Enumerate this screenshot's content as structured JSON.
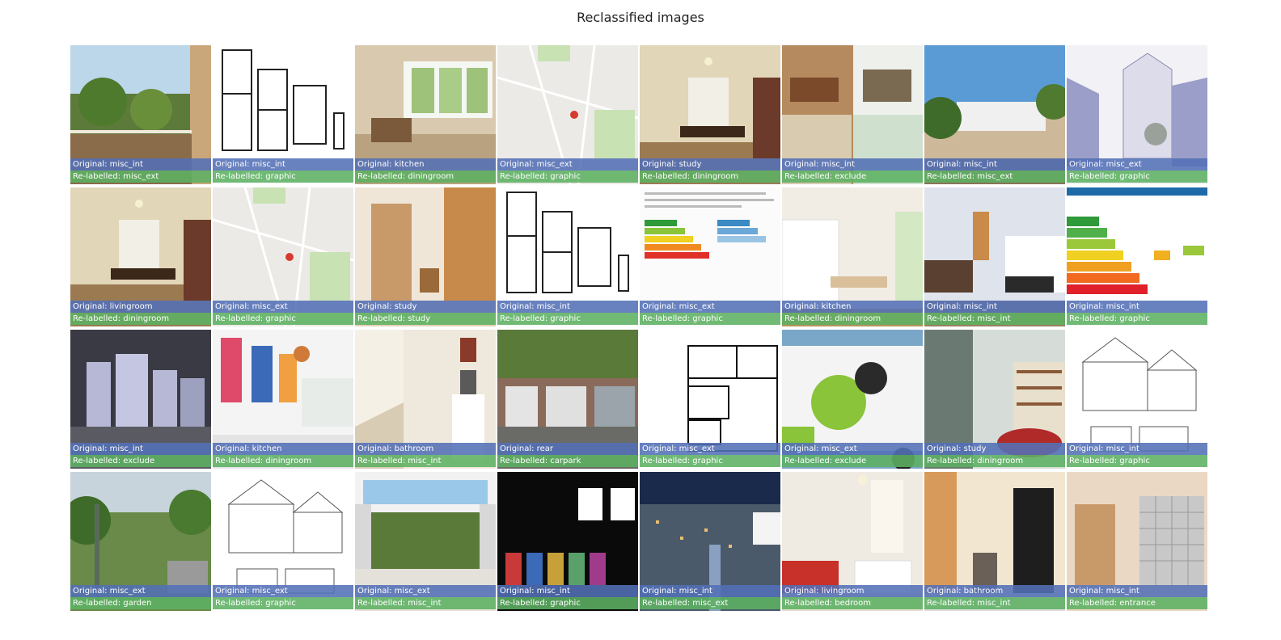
{
  "title": "Reclassified images",
  "colors": {
    "original_band": "#536fb6",
    "relabelled_band": "#5cb062"
  },
  "images": [
    {
      "original": "Original: misc_int",
      "relabelled": "Re-labelled: misc_ext",
      "scene": "balcony-view"
    },
    {
      "original": "Original: misc_int",
      "relabelled": "Re-labelled: graphic",
      "scene": "floorplan"
    },
    {
      "original": "Original: kitchen",
      "relabelled": "Re-labelled: diningroom",
      "scene": "room-window"
    },
    {
      "original": "Original: misc_ext",
      "relabelled": "Re-labelled: graphic",
      "scene": "map"
    },
    {
      "original": "Original: study",
      "relabelled": "Re-labelled: diningroom",
      "scene": "dining-room"
    },
    {
      "original": "Original: misc_int",
      "relabelled": "Re-labelled: exclude",
      "scene": "collage"
    },
    {
      "original": "Original: misc_int",
      "relabelled": "Re-labelled: misc_ext",
      "scene": "bungalow-garden"
    },
    {
      "original": "Original: misc_ext",
      "relabelled": "Re-labelled: graphic",
      "scene": "3d-render"
    },
    {
      "original": "Original: livingroom",
      "relabelled": "Re-labelled: diningroom",
      "scene": "dining-room"
    },
    {
      "original": "Original: misc_ext",
      "relabelled": "Re-labelled: graphic",
      "scene": "map"
    },
    {
      "original": "Original: study",
      "relabelled": "Re-labelled: study",
      "scene": "hallway"
    },
    {
      "original": "Original: misc_int",
      "relabelled": "Re-labelled: graphic",
      "scene": "floorplan"
    },
    {
      "original": "Original: misc_ext",
      "relabelled": "Re-labelled: graphic",
      "scene": "energy-doc"
    },
    {
      "original": "Original: kitchen",
      "relabelled": "Re-labelled: diningroom",
      "scene": "kitchen"
    },
    {
      "original": "Original: misc_int",
      "relabelled": "Re-labelled: misc_int",
      "scene": "living-kitchen"
    },
    {
      "original": "Original: misc_int",
      "relabelled": "Re-labelled: graphic",
      "scene": "energy-chart"
    },
    {
      "original": "Original: misc_int",
      "relabelled": "Re-labelled: exclude",
      "scene": "model"
    },
    {
      "original": "Original: kitchen",
      "relabelled": "Re-labelled: diningroom",
      "scene": "kitchen-art"
    },
    {
      "original": "Original: bathroom",
      "relabelled": "Re-labelled: misc_int",
      "scene": "stairs"
    },
    {
      "original": "Original: rear",
      "relabelled": "Re-labelled: carpark",
      "scene": "garages"
    },
    {
      "original": "Original: misc_ext",
      "relabelled": "Re-labelled: graphic",
      "scene": "floorplan-2"
    },
    {
      "original": "Original: misc_ext",
      "relabelled": "Re-labelled: exclude",
      "scene": "van"
    },
    {
      "original": "Original: study",
      "relabelled": "Re-labelled: diningroom",
      "scene": "library"
    },
    {
      "original": "Original: misc_int",
      "relabelled": "Re-labelled: graphic",
      "scene": "elevation"
    },
    {
      "original": "Original: misc_ext",
      "relabelled": "Re-labelled: garden",
      "scene": "garden"
    },
    {
      "original": "Original: misc_ext",
      "relabelled": "Re-labelled: graphic",
      "scene": "elevation"
    },
    {
      "original": "Original: misc_ext",
      "relabelled": "Re-labelled: misc_int",
      "scene": "extension"
    },
    {
      "original": "Original: misc_int",
      "relabelled": "Re-labelled: graphic",
      "scene": "poster"
    },
    {
      "original": "Original: misc_int",
      "relabelled": "Re-labelled: misc_ext",
      "scene": "city"
    },
    {
      "original": "Original: livingroom",
      "relabelled": "Re-labelled: bedroom",
      "scene": "sofa-room"
    },
    {
      "original": "Original: bathroom",
      "relabelled": "Re-labelled: misc_int",
      "scene": "door"
    },
    {
      "original": "Original: misc_int",
      "relabelled": "Re-labelled: entrance",
      "scene": "mailboxes"
    }
  ]
}
